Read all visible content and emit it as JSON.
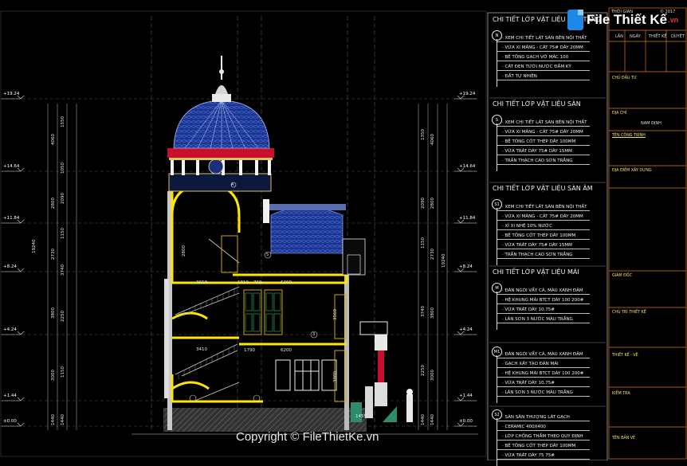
{
  "watermark": {
    "logo_text": "File Thiết Kế",
    "logo_suffix": ".vn",
    "copyright": "Copyright © FileThietKe.vn"
  },
  "levels": {
    "left": [
      "+19.24",
      "+14.64",
      "+11.84",
      "+8.24",
      "+4.24",
      "+1.44",
      "±0.00"
    ],
    "right": [
      "+19.24",
      "+14.64",
      "+11.84",
      "+8.24",
      "+4.24",
      "+1.44",
      "±0.00"
    ]
  },
  "dims": {
    "left_outer": [
      "4060",
      "2800",
      "2730",
      "3800",
      "3000",
      "1440"
    ],
    "left_inner": [
      "1550",
      "1050",
      "2090",
      "1150",
      "3740",
      "2250",
      "1150",
      "1440"
    ],
    "right_outer": [
      "4060",
      "2800",
      "2730",
      "3800",
      "3000",
      "1440"
    ],
    "right_inner": [
      "1350",
      "2090",
      "1150",
      "3740",
      "2250",
      "1440"
    ],
    "total_left": "19240",
    "total_right": "19240",
    "room_width_1": "3650",
    "room_width_2": "3410",
    "span_1": "1810",
    "span_2": "760",
    "span_3": "6200",
    "span_4": "1790",
    "span_5": "6200",
    "height_a": "3000",
    "height_b": "3560",
    "height_c": "2800",
    "height_d": "1440",
    "height_e": "1455",
    "tag_a": "A",
    "tag_b": "3",
    "tag_c": "5"
  },
  "legend": [
    {
      "title": "CHI TIẾT LỚP VẬT LIỆU NỀN TẦNG",
      "marker": "N",
      "items": [
        "XEM CHI TIẾT LÁT SÀN BÊN NỘI THẤT",
        "VỮA XI MĂNG - CÁT 75# DÀY 20MM",
        "BÊ TÔNG GẠCH VỠ MÁC 100",
        "CÁT ĐEN TƯỚI NƯỚC ĐẦM KỸ",
        "ĐẤT TỰ NHIÊN"
      ]
    },
    {
      "title": "CHI TIẾT LỚP VẬT LIỆU SÀN",
      "marker": "S",
      "items": [
        "XEM CHI TIẾT LÁT SÀN BÊN NỘI THẤT",
        "VỮA XI MĂNG - CÁT 75# DÀY 20MM",
        "BÊ TÔNG CỐT THÉP DÀY 100MM",
        "VỮA TRÁT DÀY 75# DÀY 15MM",
        "TRẦN THẠCH CAO SƠN TRẮNG"
      ]
    },
    {
      "title": "CHI TIẾT LỚP VẬT LIỆU SÀN ÂM",
      "marker": "S1",
      "items": [
        "XEM CHI TIẾT LÁT SÀN BÊN NỘI THẤT",
        "VỮA XI MĂNG - CÁT 75# DÀY 20MM",
        "XỈ XI NHỆ 10% NƯỚC",
        "BÊ TÔNG CỐT THÉP DÀY 100MM",
        "VỮA TRÁT DÀY 75# DÀY 15MM",
        "TRẦN THẠCH CAO SƠN TRẮNG"
      ]
    },
    {
      "title": "CHI TIẾT LỚP VẬT LIỆU MÁI",
      "marker": "M",
      "items": [
        "ĐÁN NGÓI VẨY CÁ, MÀU XANH ĐẬM",
        "HỆ KHUNG MÁI BTCT DÀY 100 200#",
        "VỮA TRÁT DÀY 10.75#",
        "LĂN SƠN 3 NƯỚC MÀU TRẮNG"
      ]
    },
    {
      "title": "",
      "marker": "M1",
      "items": [
        "ĐÁN NGÓI VẨY CÁ, MÀU XANH ĐẬM",
        "GẠCH XÂY TẠO ĐÁN MÁI",
        "HỆ KHUNG MÁI BTCT DÀY 100 200#",
        "VỮA TRÁT DÀY 10.75#",
        "LĂN SƠN 3 NƯỚC MÀU TRẮNG"
      ]
    },
    {
      "title": "",
      "marker": "S2",
      "items": [
        "SÀN SÂN THƯỢNG LÁT GẠCH",
        "CERAMIC 400X400",
        "LỚP CHỐNG THẤM THEO QUY ĐỊNH",
        "BÊ TÔNG CỐT THÉP DÀY 100MM",
        "VỮA TRÁT DÀY 75 75#"
      ]
    }
  ],
  "title_block": {
    "header": "THỜI GIAN",
    "year": "© 2017",
    "cols": [
      "LẦN",
      "NGÀY",
      "THIẾT KẾ",
      "DUYỆT"
    ],
    "chu_dau_tu": "CHỦ ĐẦU TƯ",
    "dia_chi": "ĐỊA CHỈ",
    "value_1": "NAM ĐỊNH",
    "ten_cong_trinh": "TÊN CÔNG TRÌNH",
    "dia_diem": "ĐỊA ĐIỂM XÂY DỰNG",
    "giam_doc": "GIÁM ĐỐC",
    "chu_tri": "CHỦ TRÌ THIẾT KẾ",
    "thiet_ke": "THIẾT KẾ - VẼ",
    "kiem_tra": "KIỂM TRA",
    "ten_ban_ve": "TÊN BẢN VẼ"
  },
  "colors": {
    "background": "#000000",
    "slab": "#ffe600",
    "dome": "#1c3a9c",
    "red_band": "#c8102e",
    "frame_orange": "#e07a00",
    "legend_panel": "#000000"
  }
}
